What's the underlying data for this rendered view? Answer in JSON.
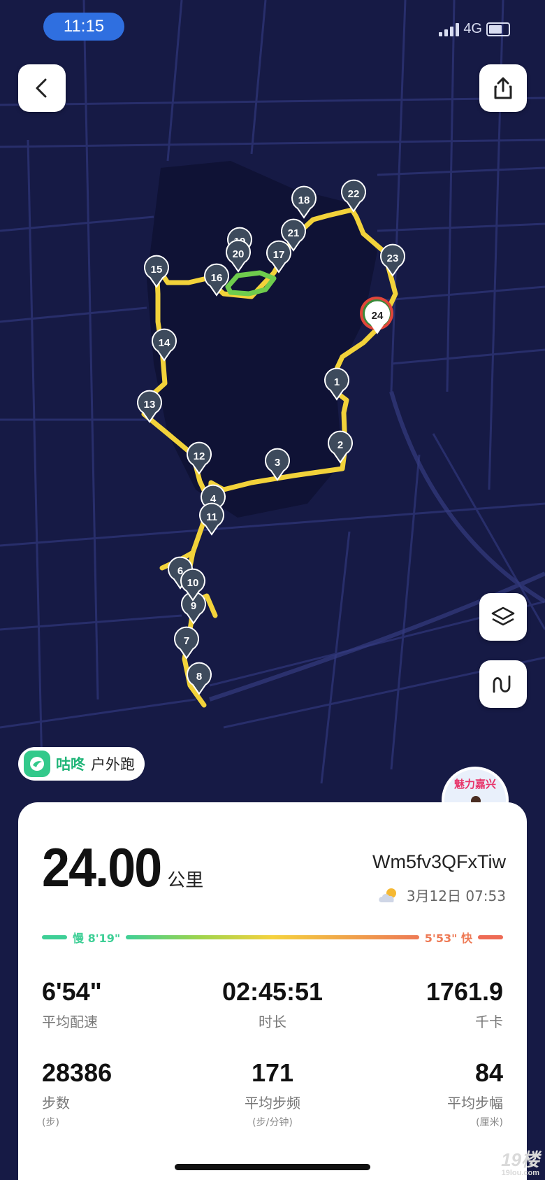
{
  "status_bar": {
    "time": "11:15",
    "network": "4G"
  },
  "map": {
    "route_color": "#f2d23a",
    "markers": [
      {
        "label": "1"
      },
      {
        "label": "2"
      },
      {
        "label": "3"
      },
      {
        "label": "4"
      },
      {
        "label": "6"
      },
      {
        "label": "7"
      },
      {
        "label": "8"
      },
      {
        "label": "9"
      },
      {
        "label": "10"
      },
      {
        "label": "11"
      },
      {
        "label": "12"
      },
      {
        "label": "13"
      },
      {
        "label": "14"
      },
      {
        "label": "15"
      },
      {
        "label": "16"
      },
      {
        "label": "17"
      },
      {
        "label": "18"
      },
      {
        "label": "19"
      },
      {
        "label": "20"
      },
      {
        "label": "21"
      },
      {
        "label": "22"
      },
      {
        "label": "23"
      },
      {
        "label": "24"
      }
    ]
  },
  "app_tag": {
    "brand": "咕咚",
    "activity": "户外跑"
  },
  "avatar": {
    "badge_text": "魅力嘉兴"
  },
  "summary": {
    "distance": "24.00",
    "distance_unit": "公里",
    "user_id": "Wm5fv3QFxTiw",
    "date_time": "3月12日 07:53",
    "pace_slow_label": "慢 8'19\"",
    "pace_fast_label": "5'53\" 快"
  },
  "stats": [
    {
      "value": "6'54\"",
      "label": "平均配速",
      "sub": ""
    },
    {
      "value": "02:45:51",
      "label": "时长",
      "sub": ""
    },
    {
      "value": "1761.9",
      "label": "千卡",
      "sub": ""
    },
    {
      "value": "28386",
      "label": "步数",
      "sub": "(步)"
    },
    {
      "value": "171",
      "label": "平均步频",
      "sub": "(步/分钟)"
    },
    {
      "value": "84",
      "label": "平均步幅",
      "sub": "(厘米)"
    }
  ],
  "watermark": {
    "main": "19楼",
    "sub": "19lou.com"
  }
}
